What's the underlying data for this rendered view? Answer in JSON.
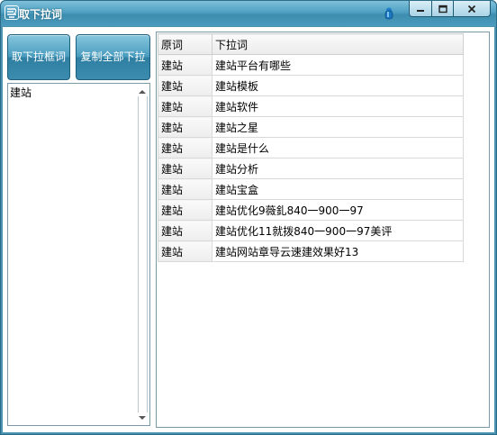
{
  "window": {
    "title": "取下拉词"
  },
  "toolbar": {
    "get_label": "取下拉框词",
    "copy_label": "复制全部下拉"
  },
  "input": {
    "text": "建站"
  },
  "table": {
    "columns": [
      "原词",
      "下拉词"
    ],
    "rows": [
      [
        "建站",
        "建站平台有哪些"
      ],
      [
        "建站",
        "建站模板"
      ],
      [
        "建站",
        "建站软件"
      ],
      [
        "建站",
        "建站之星"
      ],
      [
        "建站",
        "建站是什么"
      ],
      [
        "建站",
        "建站分析"
      ],
      [
        "建站",
        "建站宝盒"
      ],
      [
        "建站",
        "建站优化9薇釓840一900一97"
      ],
      [
        "建站",
        "建站优化11就拨840一900一97美评"
      ],
      [
        "建站",
        "建站网站章导云速建效果好13"
      ]
    ]
  },
  "icons": {
    "app": "app-logo-icon",
    "pin": "pin-icon",
    "minimize": "minimize-icon",
    "maximize": "maximize-icon",
    "close": "close-icon"
  },
  "colors": {
    "titlebar": "#4fa0c2",
    "frame": "#4a93b0",
    "button": "#3c8cb0"
  }
}
